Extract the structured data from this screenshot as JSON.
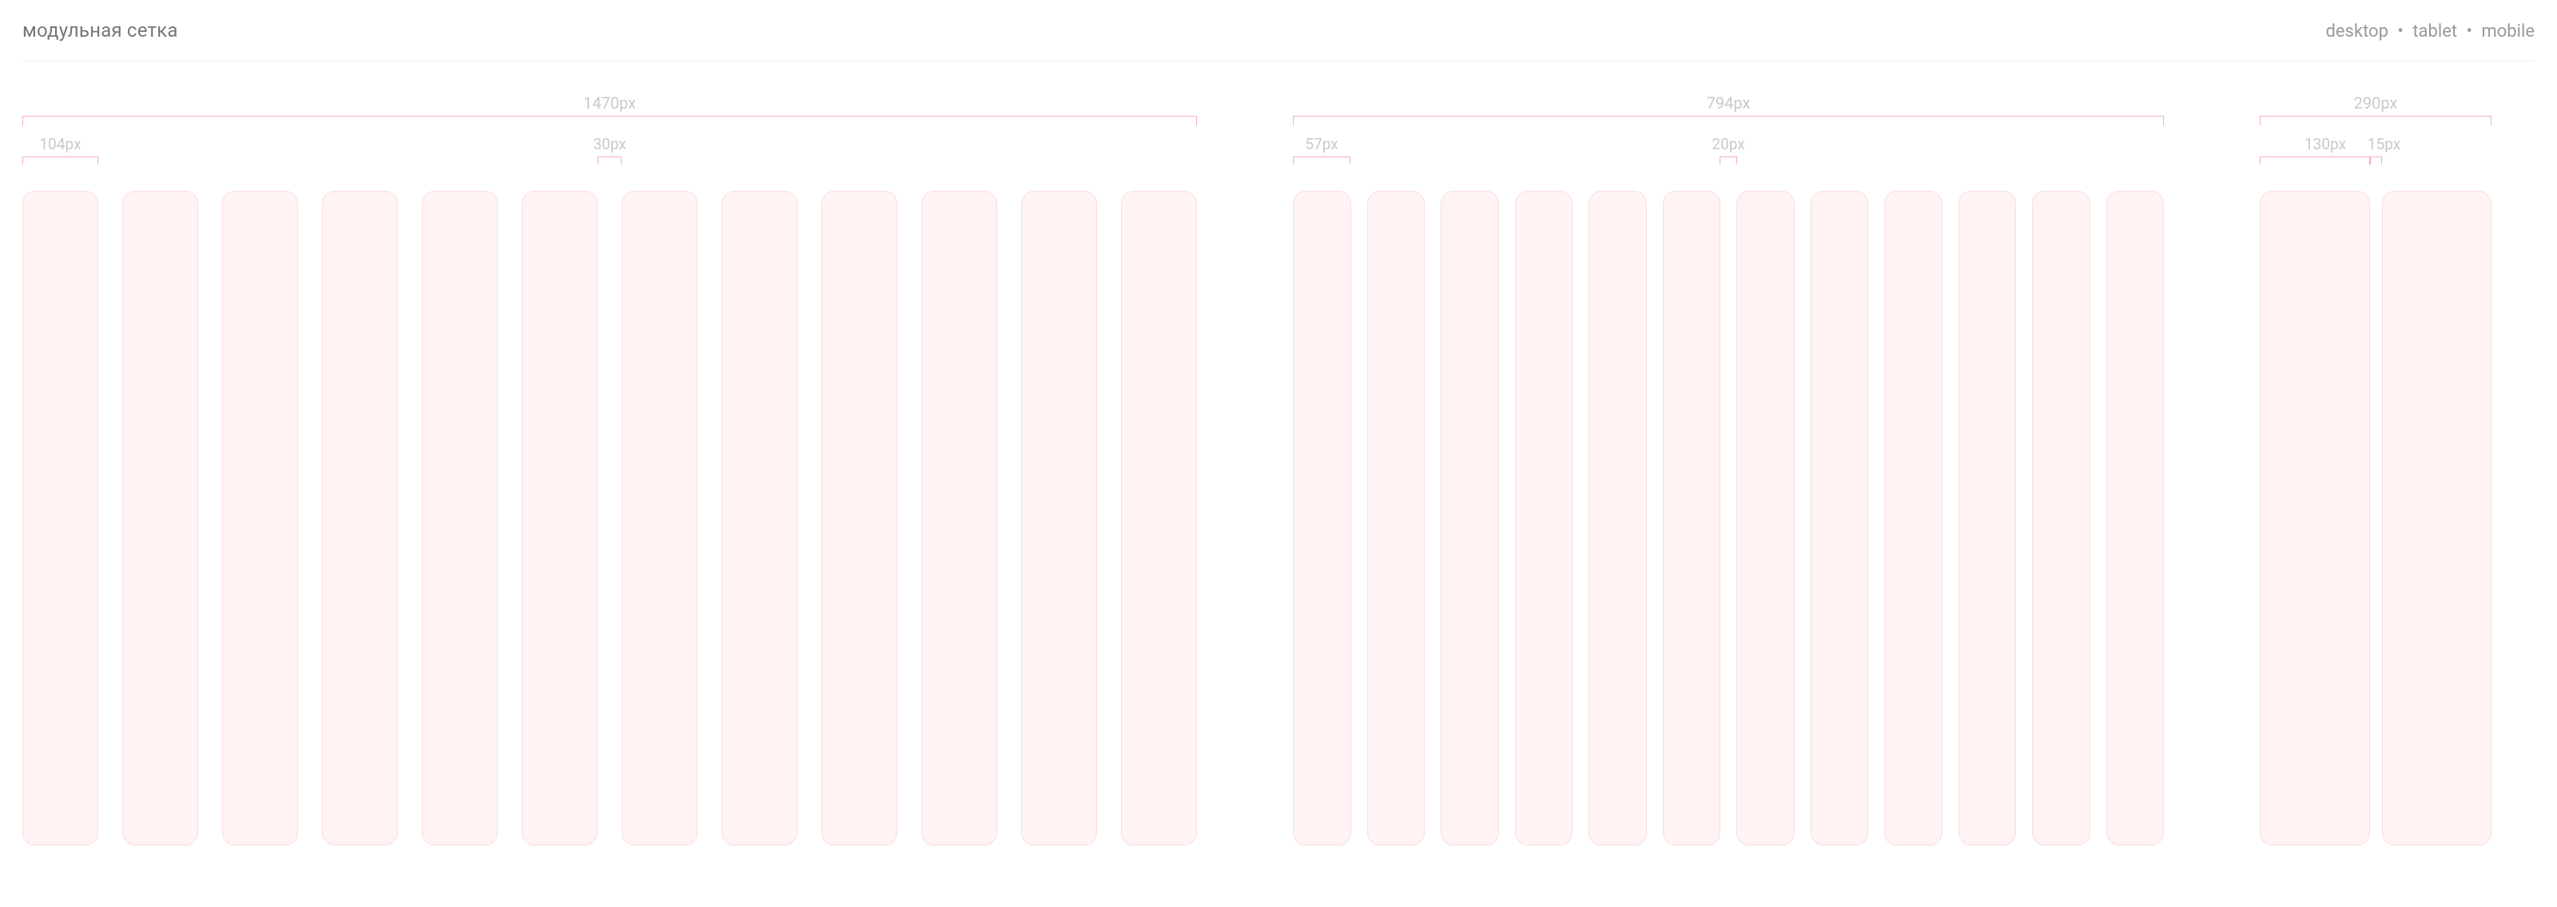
{
  "header": {
    "title": "модульная сетка",
    "breadcrumb": [
      "desktop",
      "tablet",
      "mobile"
    ],
    "sep": "•"
  },
  "grids": {
    "desktop": {
      "total_label": "1470px",
      "col_label": "104px",
      "gutter_label": "30px",
      "columns": 12
    },
    "tablet": {
      "total_label": "794px",
      "col_label": "57px",
      "gutter_label": "20px",
      "columns": 12
    },
    "mobile": {
      "total_label": "290px",
      "col_label": "130px",
      "gutter_label": "15px",
      "columns": 2
    }
  },
  "colors": {
    "column_fill": "#fff3f3",
    "column_border": "#fadde0",
    "bracket": "#f4aebd",
    "label": "#c9c9c9"
  }
}
